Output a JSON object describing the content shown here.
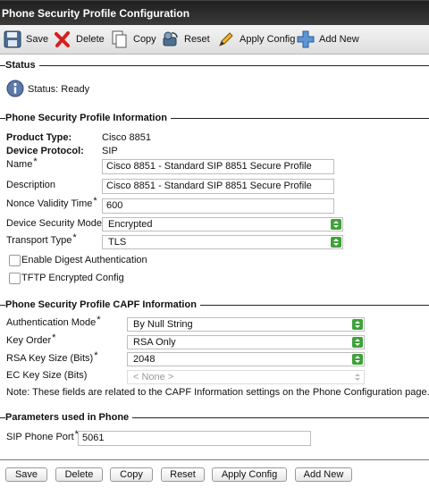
{
  "window": {
    "title": "Phone Security Profile Configuration"
  },
  "toolbar": {
    "save": {
      "label": "Save",
      "icon": "floppy-disk-icon"
    },
    "delete": {
      "label": "Delete",
      "icon": "red-x-icon"
    },
    "copy": {
      "label": "Copy",
      "icon": "copy-pages-icon"
    },
    "reset": {
      "label": "Reset",
      "icon": "reset-icon"
    },
    "apply_config": {
      "label": "Apply Config",
      "icon": "pencil-icon"
    },
    "add_new": {
      "label": "Add New",
      "icon": "plus-icon"
    }
  },
  "status": {
    "section_title": "Status",
    "text": "Status: Ready",
    "icon": "info-icon"
  },
  "profile_info": {
    "section_title": "Phone Security Profile Information",
    "product_type_label": "Product Type:",
    "product_type_value": "Cisco 8851",
    "device_protocol_label": "Device Protocol:",
    "device_protocol_value": "SIP",
    "name_label": "Name",
    "name_value": "Cisco 8851 - Standard SIP 8851 Secure Profile",
    "description_label": "Description",
    "description_value": "Cisco 8851 - Standard SIP 8851 Secure Profile",
    "nonce_label": "Nonce Validity Time",
    "nonce_value": "600",
    "device_security_mode_label": "Device Security Mode",
    "device_security_mode_value": "Encrypted",
    "transport_type_label": "Transport Type",
    "transport_type_value": "TLS",
    "digest_auth_label": "Enable Digest Authentication",
    "tftp_encrypted_label": "TFTP Encrypted Config",
    "required_mark": "*"
  },
  "capf_info": {
    "section_title": "Phone Security Profile CAPF Information",
    "auth_mode_label": "Authentication Mode",
    "auth_mode_value": "By Null String",
    "key_order_label": "Key Order",
    "key_order_value": "RSA Only",
    "rsa_key_size_label": "RSA Key Size (Bits)",
    "rsa_key_size_value": "2048",
    "ec_key_size_label": "EC Key Size (Bits)",
    "ec_key_size_value": "< None >",
    "note": "Note: These fields are related to the CAPF Information settings on the Phone Configuration page."
  },
  "phone_params": {
    "section_title": "Parameters used in Phone",
    "sip_port_label": "SIP Phone Port",
    "sip_port_value": "5061"
  },
  "bottom_buttons": {
    "save": "Save",
    "delete": "Delete",
    "copy": "Copy",
    "reset": "Reset",
    "apply_config": "Apply Config",
    "add_new": "Add New"
  },
  "colors": {
    "title_bar": "#2b2b2b",
    "select_arrow": "#3fa03a",
    "delete_icon": "#d41f1f",
    "add_icon": "#3a7bd5"
  }
}
